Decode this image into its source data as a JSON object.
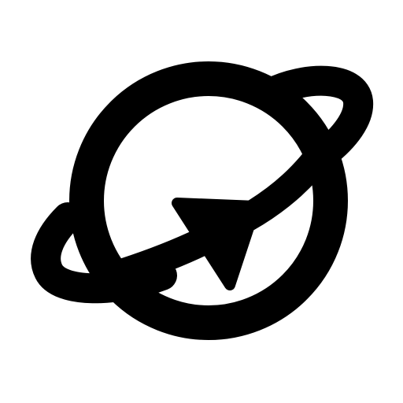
{
  "icon": {
    "name": "planet-orbit-arrow-icon",
    "color": "#000000",
    "background": "#ffffff"
  }
}
